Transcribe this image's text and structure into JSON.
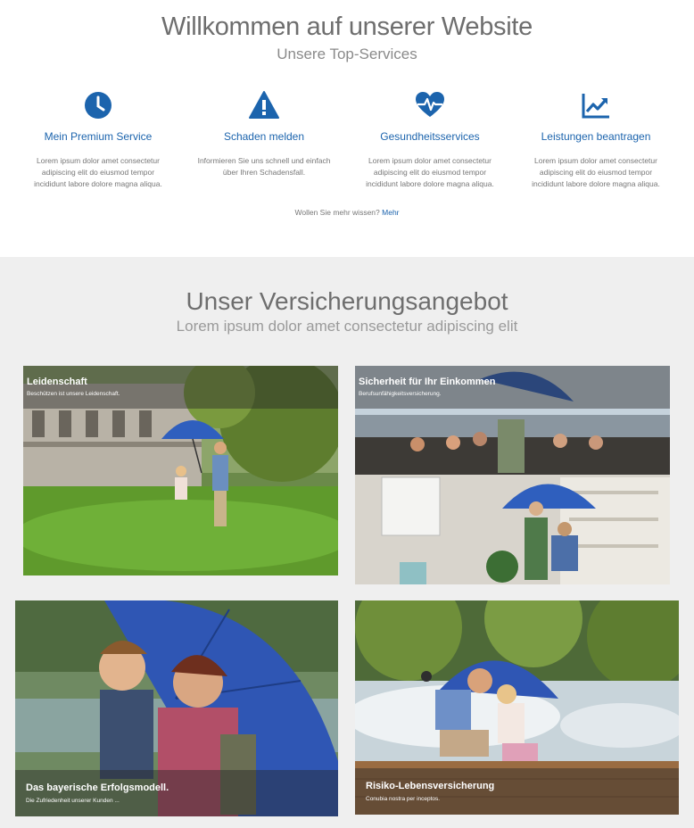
{
  "header": {
    "title": "Willkommen auf unserer Website",
    "subtitle": "Unsere Top-Services"
  },
  "services": [
    {
      "icon": "clock-icon",
      "label": "Mein Premium Service",
      "desc": "Lorem ipsum dolor amet consectetur adipiscing elit do eiusmod tempor incididunt labore dolore magna aliqua."
    },
    {
      "icon": "warning-icon",
      "label": "Schaden melden",
      "desc": "Informieren Sie uns schnell und einfach über Ihren Schadensfall."
    },
    {
      "icon": "heart-pulse-icon",
      "label": "Gesundheitsservices",
      "desc": "Lorem ipsum dolor amet consectetur adipiscing elit do eiusmod tempor incididunt labore dolore magna aliqua."
    },
    {
      "icon": "chart-trend-icon",
      "label": "Leistungen beantragen",
      "desc": "Lorem ipsum dolor amet consectetur adipiscing elit do eiusmod tempor incididunt labore dolore magna aliqua."
    }
  ],
  "more": {
    "text": "Wollen Sie mehr wissen?",
    "link": "Mehr"
  },
  "offers": {
    "title": "Unser Versicherungsangebot",
    "subtitle": "Lorem ipsum dolor amet consectetur adipiscing elit",
    "cards": [
      {
        "title": "Leidenschaft",
        "sub": "Beschützen ist unsere Leidenschaft."
      },
      {
        "title": "Sicherheit für Ihr Einkommen",
        "sub": "Berufsunfähigkeitsversicherung."
      },
      {
        "title": "Das bayerische Erfolgsmodell.",
        "sub": "Die Zufriedenheit unserer Kunden ..."
      },
      {
        "title": "Risiko-Lebensversicherung",
        "sub": "Conubia nostra per inceptos."
      }
    ]
  },
  "colors": {
    "accent": "#1c64ad",
    "section_bg": "#efefef",
    "umbrella": "#3a64c4"
  }
}
